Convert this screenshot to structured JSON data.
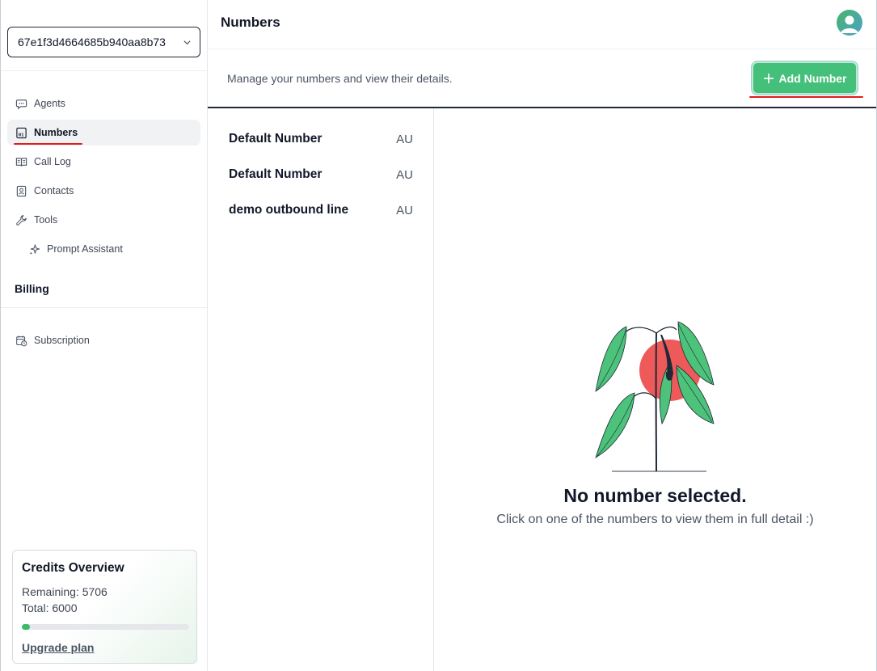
{
  "org_selector": {
    "value": "67e1f3d4664685b940aa8b73"
  },
  "sidebar": {
    "items": [
      {
        "label": "Agents",
        "icon": "chat-bubble-icon"
      },
      {
        "label": "Numbers",
        "icon": "phone-number-icon",
        "active": true
      },
      {
        "label": "Call Log",
        "icon": "book-icon"
      },
      {
        "label": "Contacts",
        "icon": "contact-card-icon"
      },
      {
        "label": "Tools",
        "icon": "wrench-icon"
      },
      {
        "label": "Prompt Assistant",
        "icon": "sparkle-icon"
      }
    ],
    "billing_title": "Billing",
    "billing_items": [
      {
        "label": "Subscription",
        "icon": "calendar-clock-icon"
      }
    ]
  },
  "credits": {
    "title": "Credits Overview",
    "remaining_text": "Remaining: 5706",
    "total_text": "Total: 6000",
    "used_fraction": 0.049,
    "upgrade_label": "Upgrade plan"
  },
  "header": {
    "title": "Numbers",
    "subtitle": "Manage your numbers and view their details.",
    "add_button_label": "Add Number"
  },
  "numbers": [
    {
      "name": "Default Number",
      "country": "AU"
    },
    {
      "name": "Default Number",
      "country": "AU"
    },
    {
      "name": "demo outbound line",
      "country": "AU"
    }
  ],
  "empty_state": {
    "title": "No number selected.",
    "subtitle": "Click on one of the numbers to view them in full detail :)"
  },
  "colors": {
    "accent_green": "#45c07a",
    "annotation_red": "#e11d1d",
    "plant_leaf": "#4cc27a",
    "plant_sun": "#ee5a5a"
  }
}
